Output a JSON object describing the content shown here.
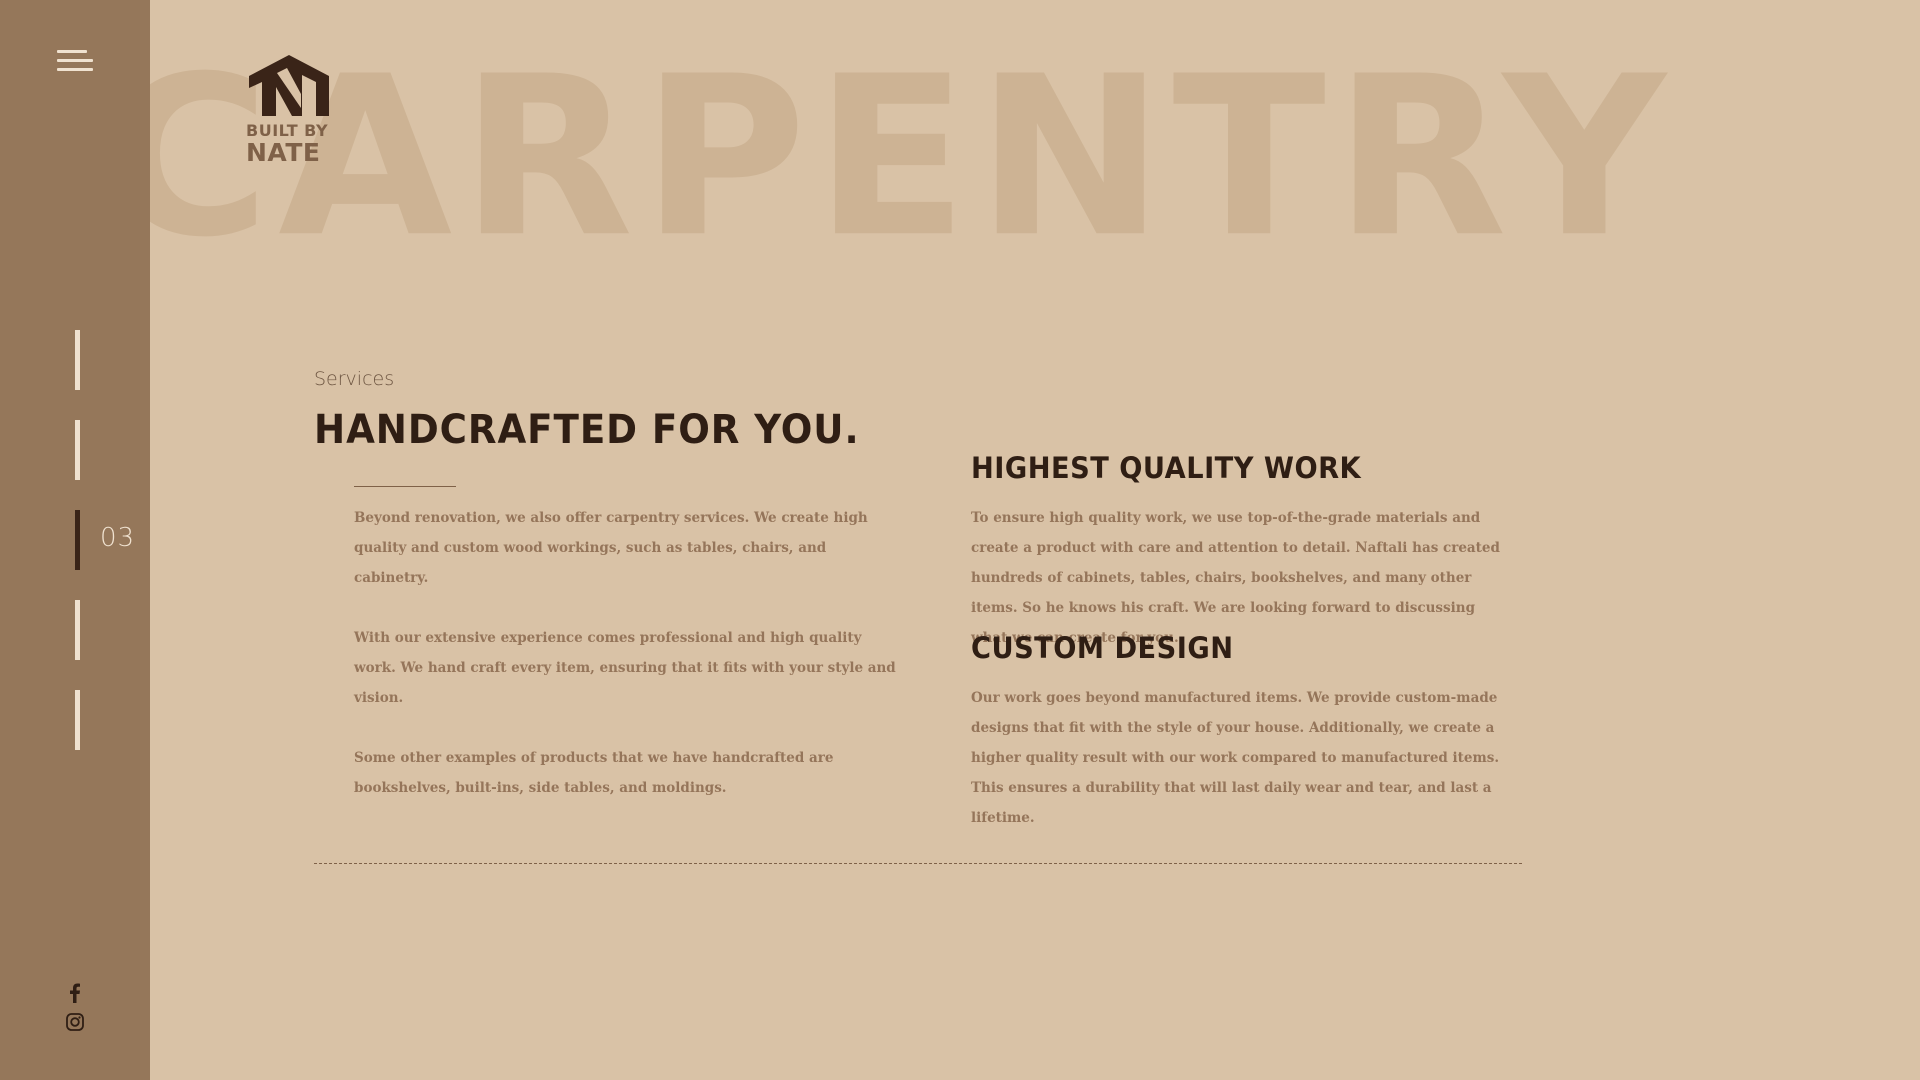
{
  "background_word": "CARPENTRY",
  "logo": {
    "line1": "BUILT BY",
    "line2": "NATE"
  },
  "sidebar": {
    "active_page": "03",
    "page_count": 5,
    "social": [
      "facebook-icon",
      "instagram-icon"
    ]
  },
  "section": {
    "eyebrow": "Services",
    "title": "HANDCRAFTED FOR YOU.",
    "paragraphs": [
      "Beyond renovation, we also offer carpentry services. We create high quality and custom wood workings, such as tables, chairs, and cabinetry.",
      "With our extensive experience comes professional and high quality work. We hand craft every item, ensuring that it fits with your style and vision.",
      "Some other examples of products that we have handcrafted are bookshelves, built-ins, side tables, and moldings."
    ]
  },
  "features": [
    {
      "title": "HIGHEST QUALITY WORK",
      "text": "To ensure high quality work, we use top-of-the-grade materials and create a product with care and attention to detail. Naftali has created hundreds of cabinets, tables, chairs, bookshelves, and many other items. So he knows his craft. We are looking forward to discussing what we can create for you."
    },
    {
      "title": "CUSTOM DESIGN",
      "text": "Our work goes beyond manufactured items. We provide custom-made designs that fit with the style of your house. Additionally, we create a higher quality result with our work compared to manufactured items. This ensures a durability that will last daily wear and tear, and last a lifetime."
    }
  ],
  "colors": {
    "background": "#d9c2a6",
    "sidebar": "#95775a",
    "heading": "#2f1e14",
    "body_text": "#95755a",
    "background_word": "#cdb394"
  }
}
